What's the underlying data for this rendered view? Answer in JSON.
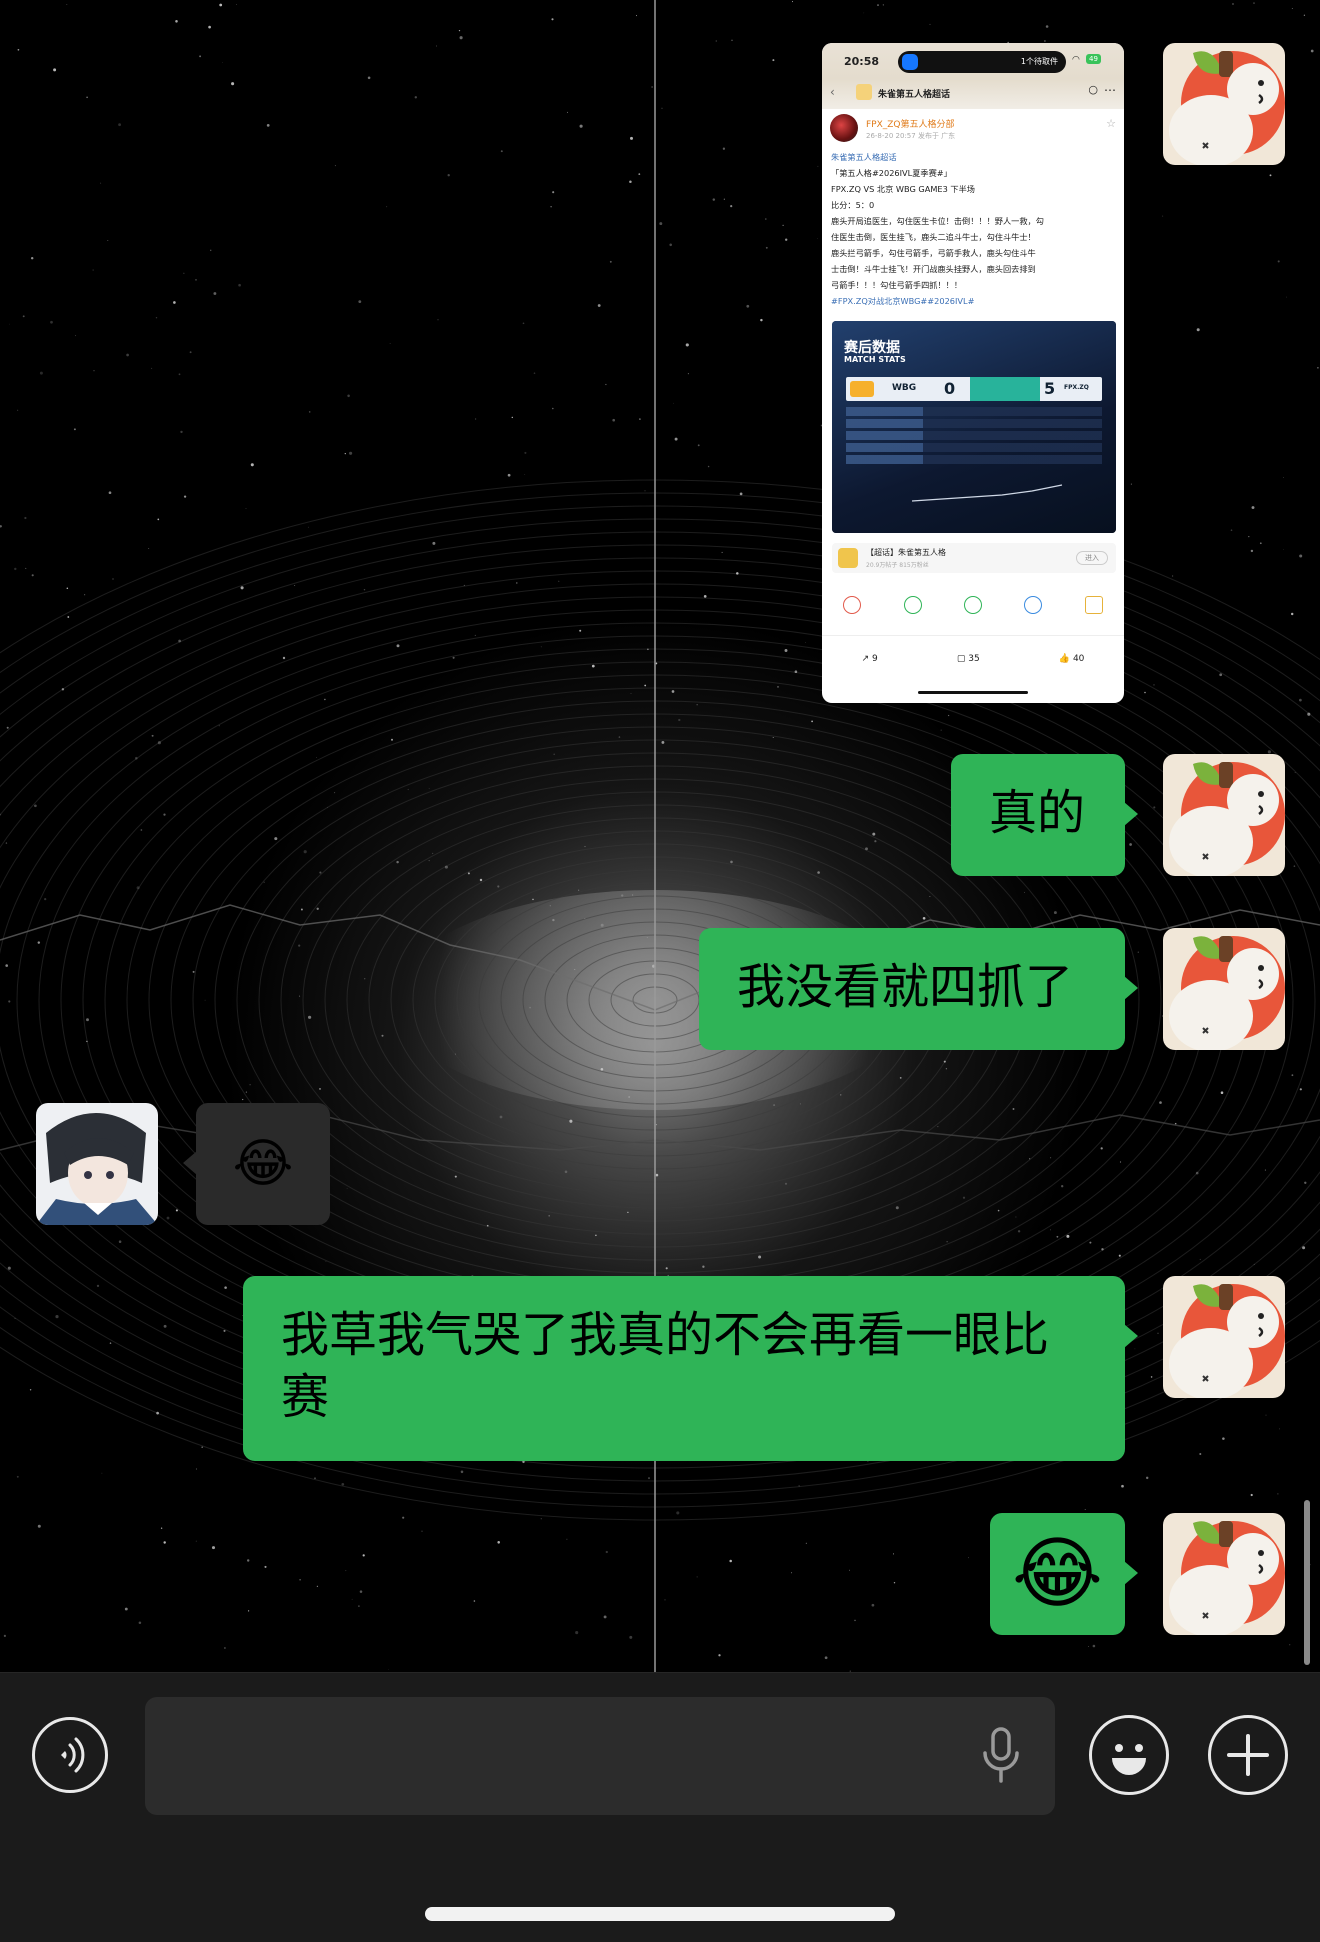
{
  "messages": [
    {
      "sender": "me",
      "type": "image",
      "description_label": "screenshot"
    },
    {
      "sender": "me",
      "type": "text",
      "text": "真的"
    },
    {
      "sender": "me",
      "type": "text",
      "text": "我没看就四抓了"
    },
    {
      "sender": "other",
      "type": "emoji",
      "text": "😂"
    },
    {
      "sender": "me",
      "type": "text",
      "text": "我草我气哭了我真的不会再看一眼比赛"
    },
    {
      "sender": "me",
      "type": "emoji",
      "text": "😂"
    }
  ],
  "shared_screenshot": {
    "status_time": "20:58",
    "island_text": "1个待取件",
    "battery": "49",
    "nav_title": "朱雀第五人格超话",
    "author": "FPX_ZQ第五人格分部",
    "post_meta": "26-8-20 20:57  发布于 广东",
    "topic": "朱雀第五人格超话",
    "lines": [
      "「第五人格#2026IVL夏季赛#」",
      "FPX.ZQ VS 北京 WBG GAME3 下半场",
      "比分：5：0",
      "鹿头开局追医生，勾住医生卡位！击倒！！！野人一救，勾",
      "住医生击倒，医生挂飞，鹿头二追斗牛士，勾住斗牛士！",
      "鹿头拦弓箭手，勾住弓箭手，弓箭手救人，鹿头勾住斗牛",
      "士击倒！斗牛士挂飞！开门战鹿头挂野人，鹿头回去排到",
      "弓箭手！！！勾住弓箭手四抓！！！"
    ],
    "hashtags": "#FPX.ZQ对战北京WBG##2026IVL#",
    "stats_title": "赛后数据",
    "stats_subtitle": "MATCH STATS",
    "team_left": "WBG",
    "score_left": "0",
    "score_right": "5",
    "team_right": "FPX.ZQ",
    "super_topic_name": "【超话】朱雀第五人格",
    "super_topic_meta": "20.9万帖子 815万粉丝",
    "enter_label": "进入",
    "share_count": "9",
    "comment_count": "35",
    "like_count": "40"
  },
  "input_bar": {
    "voice_icon": "voice-icon",
    "mic_icon": "microphone-icon",
    "emoji_icon": "smiley-icon",
    "plus_icon": "plus-icon"
  },
  "colors": {
    "bubble_green": "#2fb457",
    "bubble_dark": "#2a2a2a",
    "bar_bg": "#1b1b1b"
  }
}
